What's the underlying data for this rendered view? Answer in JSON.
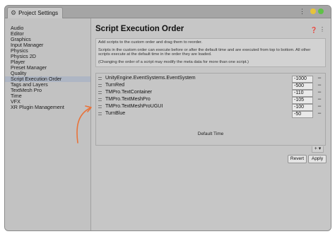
{
  "window": {
    "tab_label": "Project Settings"
  },
  "sidebar": {
    "search_placeholder": "",
    "items": [
      {
        "label": "Audio"
      },
      {
        "label": "Editor"
      },
      {
        "label": "Graphics"
      },
      {
        "label": "Input Manager"
      },
      {
        "label": "Physics"
      },
      {
        "label": "Physics 2D"
      },
      {
        "label": "Player"
      },
      {
        "label": "Preset Manager"
      },
      {
        "label": "Quality"
      },
      {
        "label": "Script Execution Order",
        "selected": true
      },
      {
        "label": "Tags and Layers"
      },
      {
        "label": "TextMesh Pro"
      },
      {
        "label": "Time"
      },
      {
        "label": "VFX"
      },
      {
        "label": "XR Plugin Management"
      }
    ]
  },
  "main": {
    "title": "Script Execution Order",
    "info": {
      "line1": "Add scripts to the custom order and drag them to reorder.",
      "line2": "Scripts in the custom order can execute before or after the default time and are executed from top to bottom. All other scripts execute at the default time in the order they are loaded.",
      "line3": "(Changing the order of a script may modify the meta data for more than one script.)"
    },
    "scripts": [
      {
        "name": "UnityEngine.EventSystems.EventSystem",
        "value": "-1000"
      },
      {
        "name": "TurnRed",
        "value": "-500"
      },
      {
        "name": "TMPro.TextContainer",
        "value": "-110"
      },
      {
        "name": "TMPro.TextMeshPro",
        "value": "-105"
      },
      {
        "name": "TMPro.TextMeshProUGUI",
        "value": "-100"
      },
      {
        "name": "TurnBlue",
        "value": "-50"
      }
    ],
    "default_time_label": "Default Time",
    "add_label": "+ ▾",
    "revert_label": "Revert",
    "apply_label": "Apply",
    "minus_label": "−"
  },
  "colors": {
    "arrow": "#e8733a",
    "selected_bg": "#aeb6c4"
  }
}
